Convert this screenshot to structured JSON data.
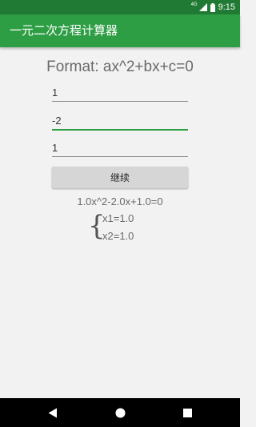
{
  "status_bar": {
    "network_label": "4G",
    "time": "9:15",
    "icons": [
      "signal-icon",
      "battery-icon"
    ]
  },
  "app_bar": {
    "title": "一元二次方程计算器",
    "color": "#2e9e44"
  },
  "main": {
    "format_text": "Format: ax^2+bx+c=0",
    "fields": {
      "a": "1",
      "b": "-2",
      "c": "1"
    },
    "continue_label": "继续",
    "equation": "1.0x^2-2.0x+1.0=0",
    "brace": "{",
    "roots": [
      "x1=1.0",
      "x2=1.0"
    ]
  },
  "nav_bar": {
    "icons": [
      "back-icon",
      "home-icon",
      "recents-icon"
    ]
  },
  "colors": {
    "status_bar": "#217a34",
    "accent": "#2e9e44",
    "background": "#f2f2f2"
  }
}
